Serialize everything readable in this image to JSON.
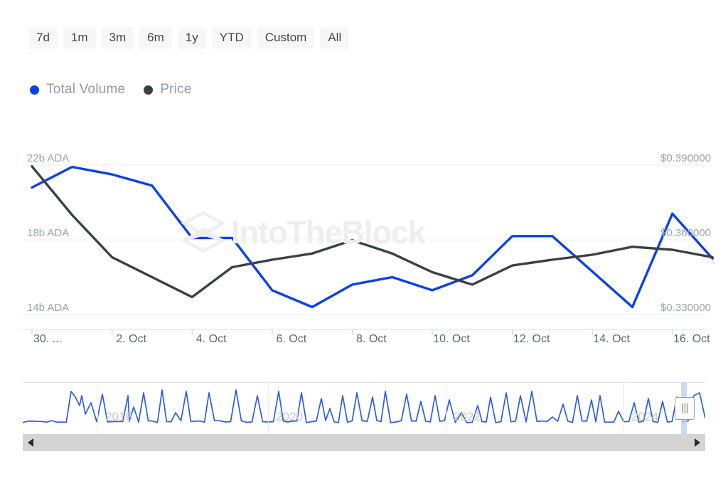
{
  "range_selector": {
    "buttons": [
      {
        "label": "7d",
        "active": false
      },
      {
        "label": "1m",
        "active": false
      },
      {
        "label": "3m",
        "active": false
      },
      {
        "label": "6m",
        "active": false
      },
      {
        "label": "1y",
        "active": false
      },
      {
        "label": "YTD",
        "active": false
      },
      {
        "label": "Custom",
        "active": false
      },
      {
        "label": "All",
        "active": false
      }
    ]
  },
  "legend": {
    "items": [
      {
        "label": "Total Volume",
        "color": "#0b41e8"
      },
      {
        "label": "Price",
        "color": "#3b4046"
      }
    ]
  },
  "watermark": {
    "text": "IntoTheBlock",
    "logo": "intotheblock-logo-icon",
    "color": "#eeeeee"
  },
  "axes": {
    "left": {
      "labels": [
        "22b ADA",
        "18b ADA",
        "14b ADA"
      ],
      "unit": "ADA"
    },
    "right": {
      "labels": [
        "$0.390000",
        "$0.360000",
        "$0.330000"
      ],
      "unit": "USD"
    },
    "x": {
      "labels": [
        "30. ...",
        "2. Oct",
        "4. Oct",
        "6. Oct",
        "8. Oct",
        "10. Oct",
        "12. Oct",
        "14. Oct",
        "16. Oct"
      ]
    }
  },
  "navigator": {
    "years": [
      "2018",
      "2020",
      "2022",
      "2024"
    ],
    "handle": "navigator-right-handle",
    "scrollbar": {
      "left_arrow": "◀",
      "right_arrow": "▶"
    }
  },
  "chart_data": {
    "type": "line",
    "title": "",
    "xlabel": "",
    "ylabel": "Total Volume (ADA)",
    "grid": true,
    "legend_position": "top-left",
    "x": [
      "30. Sep",
      "1. Oct",
      "2. Oct",
      "3. Oct",
      "4. Oct",
      "5. Oct",
      "6. Oct",
      "7. Oct",
      "8. Oct",
      "9. Oct",
      "10. Oct",
      "11. Oct",
      "12. Oct",
      "13. Oct",
      "14. Oct",
      "15. Oct",
      "16. Oct",
      "17. Oct"
    ],
    "x_tick_labels": [
      "30. ...",
      "2. Oct",
      "4. Oct",
      "6. Oct",
      "8. Oct",
      "10. Oct",
      "12. Oct",
      "14. Oct",
      "16. Oct"
    ],
    "series": [
      {
        "name": "Total Volume",
        "color": "#0b41e8",
        "unit": "ADA",
        "axis": "left",
        "ylim": [
          12.4,
          23.5
        ],
        "yticks": [
          14,
          18,
          22
        ],
        "ytick_labels": [
          "14b ADA",
          "18b ADA",
          "22b ADA"
        ],
        "values": [
          20.8,
          21.9,
          21.5,
          20.9,
          18.1,
          18.1,
          15.3,
          14.4,
          15.6,
          16.0,
          15.3,
          16.1,
          18.2,
          18.2,
          16.3,
          14.4,
          19.4,
          17.0
        ]
      },
      {
        "name": "Price",
        "color": "#3b4046",
        "unit": "USD",
        "axis": "right",
        "ylim": [
          0.3186,
          0.3963
        ],
        "yticks": [
          0.33,
          0.36,
          0.39
        ],
        "ytick_labels": [
          "$0.330000",
          "$0.360000",
          "$0.390000"
        ],
        "values": [
          0.3895,
          0.37,
          0.353,
          0.345,
          0.337,
          0.349,
          0.352,
          0.3545,
          0.3598,
          0.3545,
          0.347,
          0.342,
          0.3497,
          0.352,
          0.354,
          0.3572,
          0.356,
          0.353
        ]
      }
    ]
  }
}
